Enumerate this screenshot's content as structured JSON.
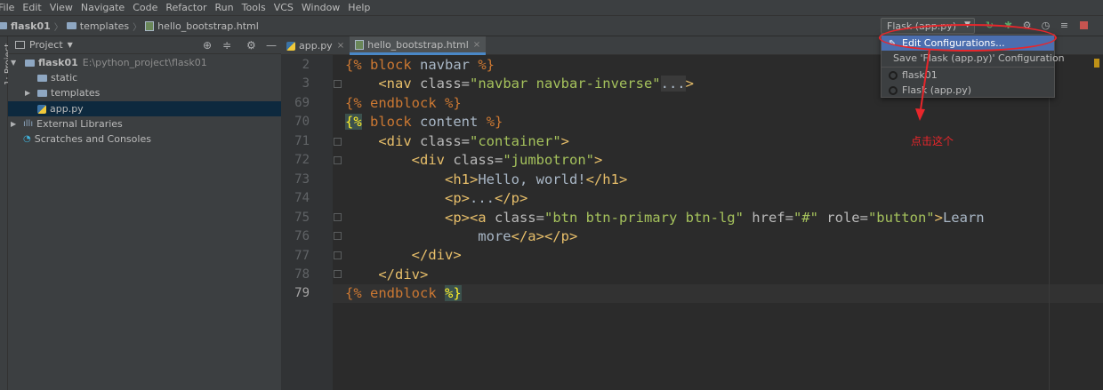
{
  "menu": [
    "File",
    "Edit",
    "View",
    "Navigate",
    "Code",
    "Refactor",
    "Run",
    "Tools",
    "VCS",
    "Window",
    "Help"
  ],
  "breadcrumb": {
    "project": "flask01",
    "folder": "templates",
    "file": "hello_bootstrap.html"
  },
  "run_config": {
    "label": "Flask (app.py)"
  },
  "sidebar_strip_label": "1: Project",
  "project_panel": {
    "title": "Project",
    "tree": [
      {
        "label": "flask01",
        "path": "E:\\python_project\\flask01"
      },
      {
        "label": "static"
      },
      {
        "label": "templates"
      },
      {
        "label": "app.py"
      },
      {
        "label": "External Libraries"
      },
      {
        "label": "Scratches and Consoles"
      }
    ]
  },
  "tabs": [
    {
      "label": "app.py"
    },
    {
      "label": "hello_bootstrap.html"
    }
  ],
  "editor": {
    "line_numbers": [
      "2",
      "3",
      "69",
      "70",
      "71",
      "72",
      "73",
      "74",
      "75",
      "76",
      "77",
      "78",
      "79"
    ],
    "current_line": "79"
  },
  "dropdown": {
    "items": [
      "Edit Configurations...",
      "Save 'Flask (app.py)' Configuration",
      "flask01",
      "Flask (app.py)"
    ]
  },
  "annotation": {
    "text": "点击这个",
    "color": "#e8262b"
  }
}
